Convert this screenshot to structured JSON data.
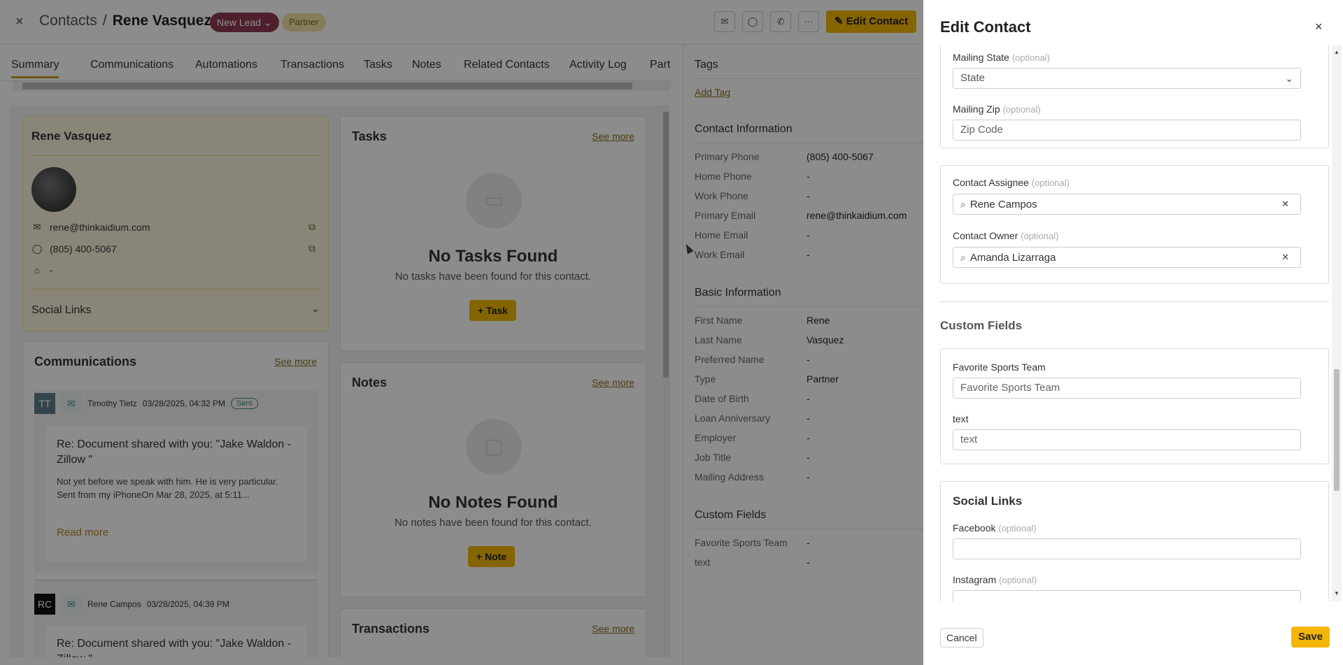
{
  "header": {
    "close": "×",
    "breadcrumb_root": "Contacts",
    "breadcrumb_sep": "/",
    "contact_name": "Rene Vasquez",
    "status_badge": "New Lead",
    "type_badge": "Partner",
    "edit_button": "Edit Contact",
    "more_glyph": "···"
  },
  "tabs": [
    "Summary",
    "Communications",
    "Automations",
    "Transactions",
    "Tasks",
    "Notes",
    "Related Contacts",
    "Activity Log",
    "Part"
  ],
  "profile": {
    "name": "Rene Vasquez",
    "email": "rene@thinkaidium.com",
    "phone": "(805) 400-5067",
    "address": "-",
    "social_links": "Social Links"
  },
  "communications": {
    "title": "Communications",
    "see_more": "See more",
    "items": [
      {
        "initials": "TT",
        "author": "Timothy Tietz",
        "date": "03/28/2025, 04:32 PM",
        "status": "Sent",
        "subject": "Re: Document shared with you: \"Jake Waldon - Zillow \"",
        "body": "Not yet before we speak with him. He is very particular. Sent from my iPhoneOn Mar 28, 2025, at 5:11...",
        "read_more": "Read more"
      },
      {
        "initials": "RC",
        "author": "Rene Campos",
        "date": "03/28/2025, 04:39 PM",
        "subject": "Re: Document shared with you: \"Jake Waldon - Zillow \""
      }
    ]
  },
  "tasks": {
    "title": "Tasks",
    "see_more": "See more",
    "empty_title": "No Tasks Found",
    "empty_sub": "No tasks have been found for this contact.",
    "button": "Task"
  },
  "notes": {
    "title": "Notes",
    "see_more": "See more",
    "empty_title": "No Notes Found",
    "empty_sub": "No notes have been found for this contact.",
    "button": "Note"
  },
  "transactions": {
    "title": "Transactions",
    "see_more": "See more"
  },
  "right_panel": {
    "tags_title": "Tags",
    "add_tag": "Add Tag",
    "contact_info_title": "Contact Information",
    "contact_info": [
      {
        "k": "Primary Phone",
        "v": "(805) 400-5067"
      },
      {
        "k": "Home Phone",
        "v": "-"
      },
      {
        "k": "Work Phone",
        "v": "-"
      },
      {
        "k": "Primary Email",
        "v": "rene@thinkaidium.com"
      },
      {
        "k": "Home Email",
        "v": "-"
      },
      {
        "k": "Work Email",
        "v": "-"
      }
    ],
    "basic_info_title": "Basic Information",
    "basic_info": [
      {
        "k": "First Name",
        "v": "Rene"
      },
      {
        "k": "Last Name",
        "v": "Vasquez"
      },
      {
        "k": "Preferred Name",
        "v": "-"
      },
      {
        "k": "Type",
        "v": "Partner"
      },
      {
        "k": "Date of Birth",
        "v": "-"
      },
      {
        "k": "Loan Anniversary",
        "v": "-"
      },
      {
        "k": "Employer",
        "v": "-"
      },
      {
        "k": "Job Title",
        "v": "-"
      },
      {
        "k": "Mailing Address",
        "v": "-"
      }
    ],
    "custom_fields_title": "Custom Fields",
    "custom_fields": [
      {
        "k": "Favorite Sports Team",
        "v": "-"
      },
      {
        "k": "text",
        "v": "-"
      }
    ]
  },
  "drawer": {
    "title": "Edit Contact",
    "close": "×",
    "optional": "(optional)",
    "mailing_state_label": "Mailing State",
    "mailing_state_value": "State",
    "mailing_zip_label": "Mailing Zip",
    "mailing_zip_placeholder": "Zip Code",
    "assignee_label": "Contact Assignee",
    "assignee_value": "Rene Campos",
    "owner_label": "Contact Owner",
    "owner_value": "Amanda Lizarraga",
    "custom_fields_title": "Custom Fields",
    "fav_team_label": "Favorite Sports Team",
    "fav_team_placeholder": "Favorite Sports Team",
    "text_label": "text",
    "text_placeholder": "text",
    "social_links_title": "Social Links",
    "facebook_label": "Facebook",
    "instagram_label": "Instagram",
    "cancel": "Cancel",
    "save": "Save"
  },
  "colors": {
    "accent": "#f2b705",
    "lead_badge": "#8c3b50",
    "partner_badge": "#f4e2a6"
  }
}
